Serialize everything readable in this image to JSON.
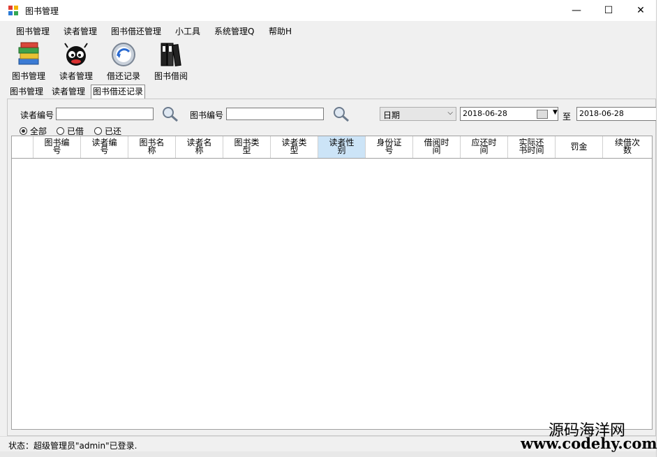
{
  "window": {
    "title": "图书管理",
    "minimize": "—",
    "maximize": "☐",
    "close": "✕"
  },
  "menu": [
    "图书管理",
    "读者管理",
    "图书借还管理",
    "小工具",
    "系统管理Q",
    "帮助H"
  ],
  "toolbar": [
    {
      "label": "图书管理",
      "icon": "books-icon"
    },
    {
      "label": "读者管理",
      "icon": "reader-icon"
    },
    {
      "label": "借还记录",
      "icon": "history-icon"
    },
    {
      "label": "图书借阅",
      "icon": "binders-icon"
    }
  ],
  "tabs": [
    "图书管理",
    "读者管理",
    "图书借还记录"
  ],
  "filters": {
    "reader_label": "读者编号",
    "reader_value": "",
    "book_label": "图书编号",
    "book_value": "",
    "date_type": "日期",
    "date_from": "2018-06-28",
    "to_label": "至",
    "date_to": "2018-06-28"
  },
  "radios": [
    {
      "label": "全部",
      "checked": true
    },
    {
      "label": "已借",
      "checked": false
    },
    {
      "label": "已还",
      "checked": false
    }
  ],
  "columns": [
    "图书编号",
    "读者编号",
    "图书名称",
    "读者名称",
    "图书类型",
    "读者类型",
    "读者性别",
    "身份证号",
    "借阅时间",
    "应还时间",
    "实际还书时间",
    "罚金",
    "续借次数"
  ],
  "rows": [],
  "status": "状态：超级管理员\"admin\"已登录.",
  "watermark": {
    "cn": "源码海洋网",
    "url": "www.codehy.com"
  },
  "colors": {
    "selected_header": "#cce4f7",
    "window_bg": "#f0f0f0"
  }
}
